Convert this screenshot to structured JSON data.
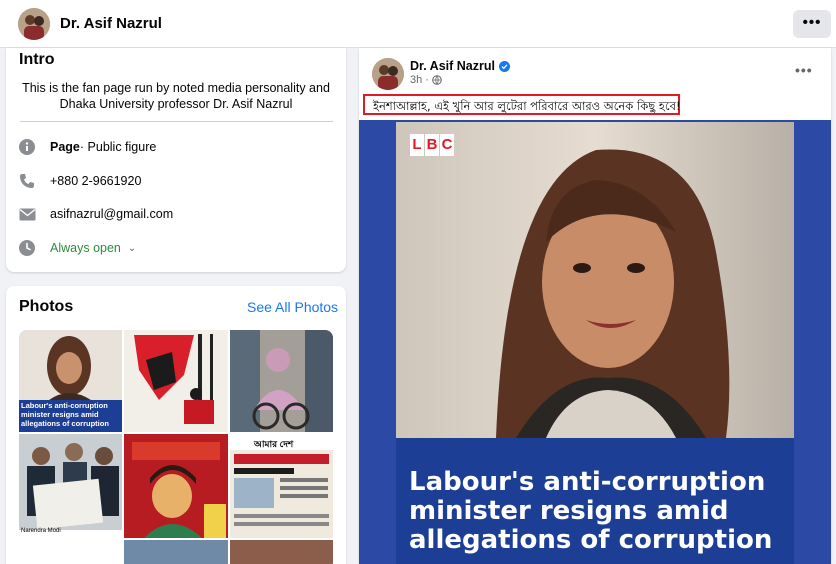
{
  "header": {
    "page_name": "Dr. Asif Nazrul",
    "more_label": "•••"
  },
  "intro": {
    "title": "Intro",
    "description": "This is the fan page run by noted media personality and Dhaka University professor Dr. Asif Nazrul",
    "page_label": "Page",
    "category": " · Public figure",
    "phone": "+880 2-9661920",
    "email": "asifnazrul@gmail.com",
    "hours": "Always open",
    "hours_color": "#2e8b3e"
  },
  "photos": {
    "title": "Photos",
    "see_all": "See All Photos",
    "tiles": [
      {
        "caption": "Labour's anti-corruption minister resigns amid allegations of corruption",
        "icon": "news-photo"
      },
      {
        "caption": "",
        "icon": "illustration-art"
      },
      {
        "caption": "",
        "icon": "wheelchair-photo"
      },
      {
        "caption": "",
        "icon": "newspaper-reader-photo",
        "label": "Narendra Modi"
      },
      {
        "caption": "",
        "icon": "portrait-illustration"
      },
      {
        "caption": "",
        "icon": "newspaper-clipping",
        "label": "আমার দেশ"
      },
      {
        "caption": "",
        "icon": "photo"
      },
      {
        "caption": "",
        "icon": "photo"
      }
    ]
  },
  "post": {
    "author": "Dr. Asif Nazrul",
    "time": "3h ·",
    "text": "ইনশাআল্লাহ, এই খুনি আর লুটেরা পরিবারে আরও অনেক কিছু  হবে!",
    "more_label": "•••",
    "image": {
      "logo": [
        "L",
        "B",
        "C"
      ],
      "headline": "Labour's anti-corruption minister resigns amid allegations of corruption"
    },
    "highlight_color": "#e01b24"
  },
  "colors": {
    "link": "#1877f2",
    "banner": "#1c3f95",
    "media_bg": "#2d49a6"
  }
}
